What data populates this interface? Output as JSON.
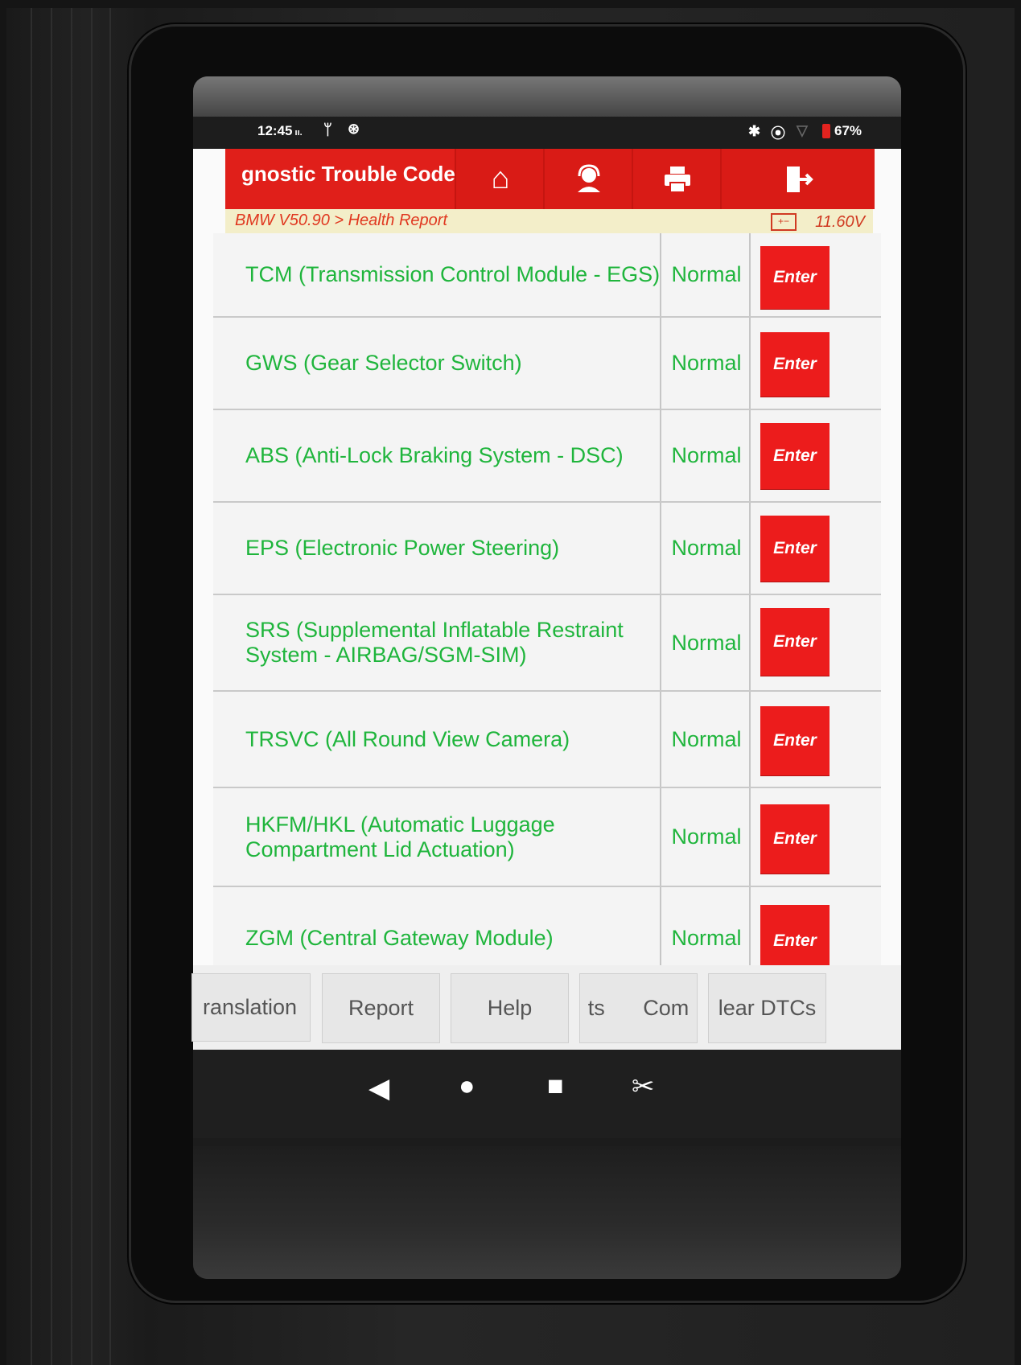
{
  "status_bar": {
    "time": "12:45",
    "time_suffix": "ıı.",
    "battery_percent": "67%",
    "icons": [
      "usb-icon",
      "camera-icon",
      "bluetooth-icon",
      "location-icon",
      "signal-icon",
      "battery-icon"
    ]
  },
  "title_bar": {
    "title": "gnostic Trouble Code",
    "buttons": [
      "home-icon",
      "support-agent-icon",
      "print-icon",
      "exit-icon"
    ]
  },
  "breadcrumb": {
    "path": "BMW V50.90 > Health Report",
    "voltage": "11.60V"
  },
  "modules": [
    {
      "name": "TCM (Transmission Control Module - EGS)",
      "status": "Normal",
      "action": "Enter"
    },
    {
      "name": "GWS (Gear Selector Switch)",
      "status": "Normal",
      "action": "Enter"
    },
    {
      "name": "ABS (Anti-Lock Braking System - DSC)",
      "status": "Normal",
      "action": "Enter"
    },
    {
      "name": "EPS (Electronic Power Steering)",
      "status": "Normal",
      "action": "Enter"
    },
    {
      "name": "SRS (Supplemental Inflatable Restraint System - AIRBAG/SGM-SIM)",
      "status": "Normal",
      "action": "Enter"
    },
    {
      "name": "TRSVC (All Round View Camera)",
      "status": "Normal",
      "action": "Enter"
    },
    {
      "name": "HKFM/HKL (Automatic Luggage Compartment Lid Actuation)",
      "status": "Normal",
      "action": "Enter"
    },
    {
      "name": "ZGM (Central Gateway Module)",
      "status": "Normal",
      "action": "Enter"
    }
  ],
  "bottom_buttons": [
    "ranslation",
    "Report",
    "Help",
    "ts Com",
    "lear DTCs"
  ],
  "colors": {
    "brand_red": "#e01f1a",
    "status_green": "#1fb53c",
    "breadcrumb_bg": "#f3eec9"
  }
}
